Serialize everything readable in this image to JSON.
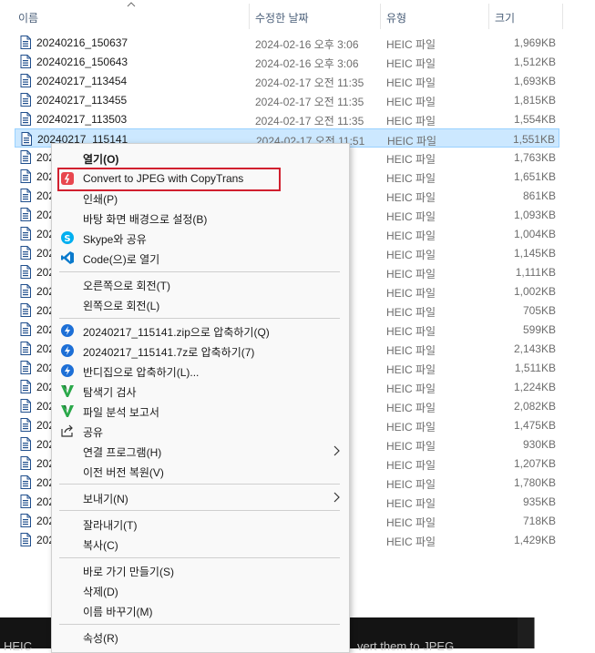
{
  "columns": {
    "name": "이름",
    "date": "수정한 날짜",
    "type": "유형",
    "size": "크기"
  },
  "files": [
    {
      "name": "20240216_150637",
      "date": "2024-02-16 오후 3:06",
      "type": "HEIC 파일",
      "size": "1,969KB"
    },
    {
      "name": "20240216_150643",
      "date": "2024-02-16 오후 3:06",
      "type": "HEIC 파일",
      "size": "1,512KB"
    },
    {
      "name": "20240217_113454",
      "date": "2024-02-17 오전 11:35",
      "type": "HEIC 파일",
      "size": "1,693KB"
    },
    {
      "name": "20240217_113455",
      "date": "2024-02-17 오전 11:35",
      "type": "HEIC 파일",
      "size": "1,815KB"
    },
    {
      "name": "20240217_113503",
      "date": "2024-02-17 오전 11:35",
      "type": "HEIC 파일",
      "size": "1,554KB"
    },
    {
      "name": "20240217_115141",
      "date": "2024-02-17 오전 11:51",
      "type": "HEIC 파일",
      "size": "1,551KB",
      "selected": true
    },
    {
      "name": "202",
      "date": "51",
      "type": "HEIC 파일",
      "size": "1,763KB"
    },
    {
      "name": "202",
      "date": "51",
      "type": "HEIC 파일",
      "size": "1,651KB"
    },
    {
      "name": "202",
      "date": "32",
      "type": "HEIC 파일",
      "size": "861KB"
    },
    {
      "name": "202",
      "date": "33",
      "type": "HEIC 파일",
      "size": "1,093KB"
    },
    {
      "name": "202",
      "date": "31",
      "type": "HEIC 파일",
      "size": "1,004KB"
    },
    {
      "name": "202",
      "date": "32",
      "type": "HEIC 파일",
      "size": "1,145KB"
    },
    {
      "name": "202",
      "date": "32",
      "type": "HEIC 파일",
      "size": "1,111KB"
    },
    {
      "name": "202",
      "date": "32",
      "type": "HEIC 파일",
      "size": "1,002KB"
    },
    {
      "name": "202",
      "date": "32",
      "type": "HEIC 파일",
      "size": "705KB"
    },
    {
      "name": "202",
      "date": "32",
      "type": "HEIC 파일",
      "size": "599KB"
    },
    {
      "name": "202",
      "date": "50",
      "type": "HEIC 파일",
      "size": "2,143KB"
    },
    {
      "name": "202",
      "date": "30",
      "type": "HEIC 파일",
      "size": "1,511KB"
    },
    {
      "name": "202",
      "date": "30",
      "type": "HEIC 파일",
      "size": "1,224KB"
    },
    {
      "name": "202",
      "date": "30",
      "type": "HEIC 파일",
      "size": "2,082KB"
    },
    {
      "name": "202",
      "date": "30",
      "type": "HEIC 파일",
      "size": "1,475KB"
    },
    {
      "name": "202",
      "date": "30",
      "type": "HEIC 파일",
      "size": "930KB"
    },
    {
      "name": "202",
      "date": "30",
      "type": "HEIC 파일",
      "size": "1,207KB"
    },
    {
      "name": "202",
      "date": "06",
      "type": "HEIC 파일",
      "size": "1,780KB"
    },
    {
      "name": "202",
      "date": "30",
      "type": "HEIC 파일",
      "size": "935KB"
    },
    {
      "name": "202",
      "date": "30",
      "type": "HEIC 파일",
      "size": "718KB"
    },
    {
      "name": "202",
      "date": "30",
      "type": "HEIC 파일",
      "size": "1,429KB"
    }
  ],
  "context_menu": {
    "open": "열기(O)",
    "convert": "Convert to JPEG with CopyTrans",
    "print": "인쇄(P)",
    "set_wallpaper": "바탕 화면 배경으로 설정(B)",
    "skype_share": "Skype와 공유",
    "open_with_code": "Code(으)로 열기",
    "rotate_right": "오른쪽으로 회전(T)",
    "rotate_left": "왼쪽으로 회전(L)",
    "zip": "20240217_115141.zip으로 압축하기(Q)",
    "sevenzip": "20240217_115141.7z로 압축하기(7)",
    "bandizip": "반디집으로 압축하기(L)...",
    "scan": "탐색기 검사",
    "analyze": "파일 분석 보고서",
    "share": "공유",
    "open_with": "연결 프로그램(H)",
    "restore": "이전 버전 복원(V)",
    "send_to": "보내기(N)",
    "cut": "잘라내기(T)",
    "copy": "복사(C)",
    "shortcut": "바로 가기 만들기(S)",
    "delete": "삭제(D)",
    "rename": "이름 바꾸기(M)",
    "properties": "속성(R)"
  },
  "background_text": {
    "left": "HEIC",
    "right": "vert them to JPEG"
  },
  "colors": {
    "selection": "#cce8ff",
    "highlight_box": "#d1202f",
    "header_text": "#4c607a"
  }
}
